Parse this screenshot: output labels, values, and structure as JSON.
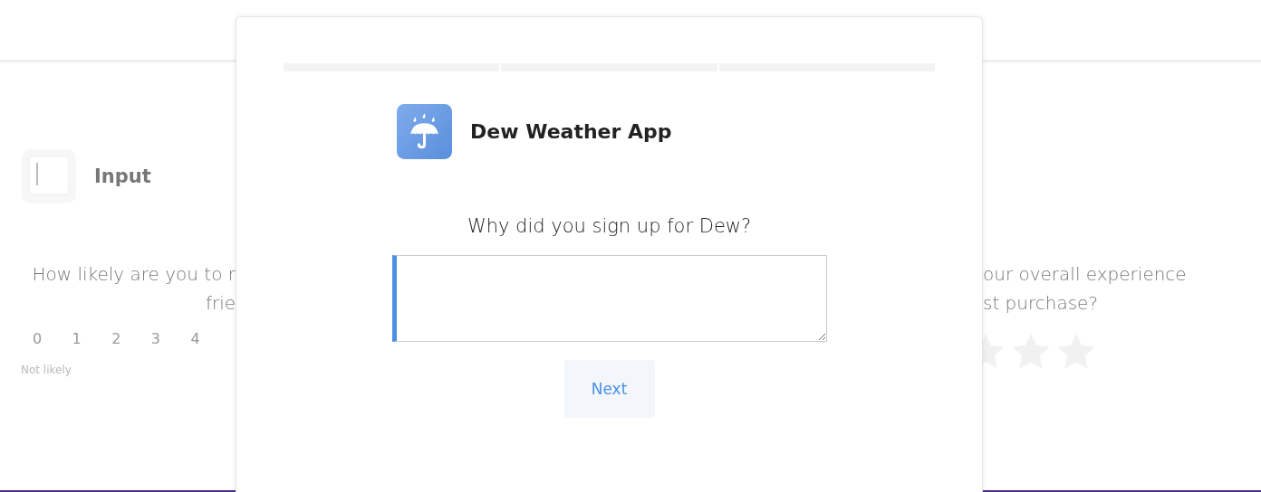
{
  "background": {
    "left_card": {
      "title": "Input",
      "question_lines": [
        "How likely are you to r",
        "frie"
      ],
      "scale": [
        "0",
        "1",
        "2",
        "3",
        "4"
      ],
      "low_label": "Not likely"
    },
    "right_card": {
      "question_lines": [
        "our overall experience",
        "st purchase?"
      ],
      "rating": {
        "items": [
          {
            "filled": false
          },
          {
            "filled": false
          },
          {
            "filled": false
          }
        ]
      }
    }
  },
  "dialog": {
    "progress": [
      {
        "done": false
      },
      {
        "done": false
      },
      {
        "done": false
      }
    ],
    "app_name": "Dew Weather App",
    "question": "Why did you sign up for Dew?",
    "answer": {
      "focused": true
    },
    "next_button": "Next"
  }
}
